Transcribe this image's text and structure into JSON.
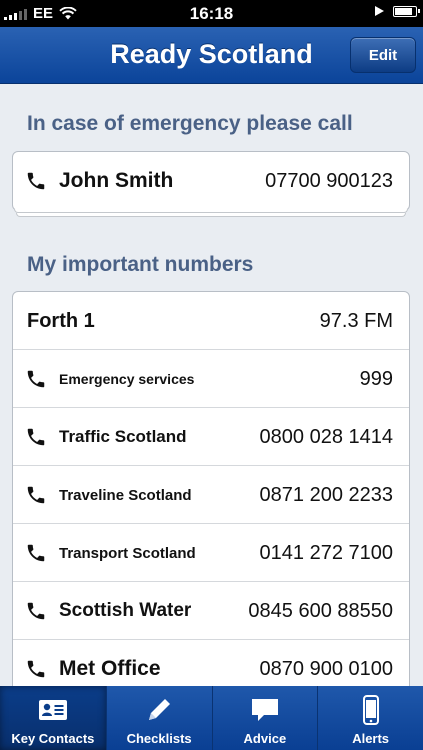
{
  "status_bar": {
    "carrier": "EE",
    "time": "16:18",
    "battery_level": 0.85
  },
  "navbar": {
    "title": "Ready Scotland",
    "edit_label": "Edit"
  },
  "emergency": {
    "heading": "In case of emergency please call",
    "contact": {
      "name": "John Smith",
      "number": "07700 900123"
    }
  },
  "important": {
    "heading": "My important numbers",
    "rows": [
      {
        "name": "Forth 1",
        "number": "97.3 FM"
      },
      {
        "name": "Emergency services",
        "number": "999"
      },
      {
        "name": "Traffic Scotland",
        "number": "0800 028 1414"
      },
      {
        "name": "Traveline Scotland",
        "number": "0871 200 2233"
      },
      {
        "name": "Transport Scotland",
        "number": "0141 272 7100"
      },
      {
        "name": "Scottish Water",
        "number": "0845 600 88550"
      },
      {
        "name": "Met Office",
        "number": "0870 900 0100"
      }
    ]
  },
  "tabs": [
    {
      "label": "Key Contacts",
      "icon": "contact-card-icon",
      "active": true
    },
    {
      "label": "Checklists",
      "icon": "pencil-icon",
      "active": false
    },
    {
      "label": "Advice",
      "icon": "speech-bubble-icon",
      "active": false
    },
    {
      "label": "Alerts",
      "icon": "phone-device-icon",
      "active": false
    }
  ],
  "colors": {
    "nav_blue": "#0b449a",
    "section_text": "#4a6186",
    "background": "#e9edf2"
  }
}
